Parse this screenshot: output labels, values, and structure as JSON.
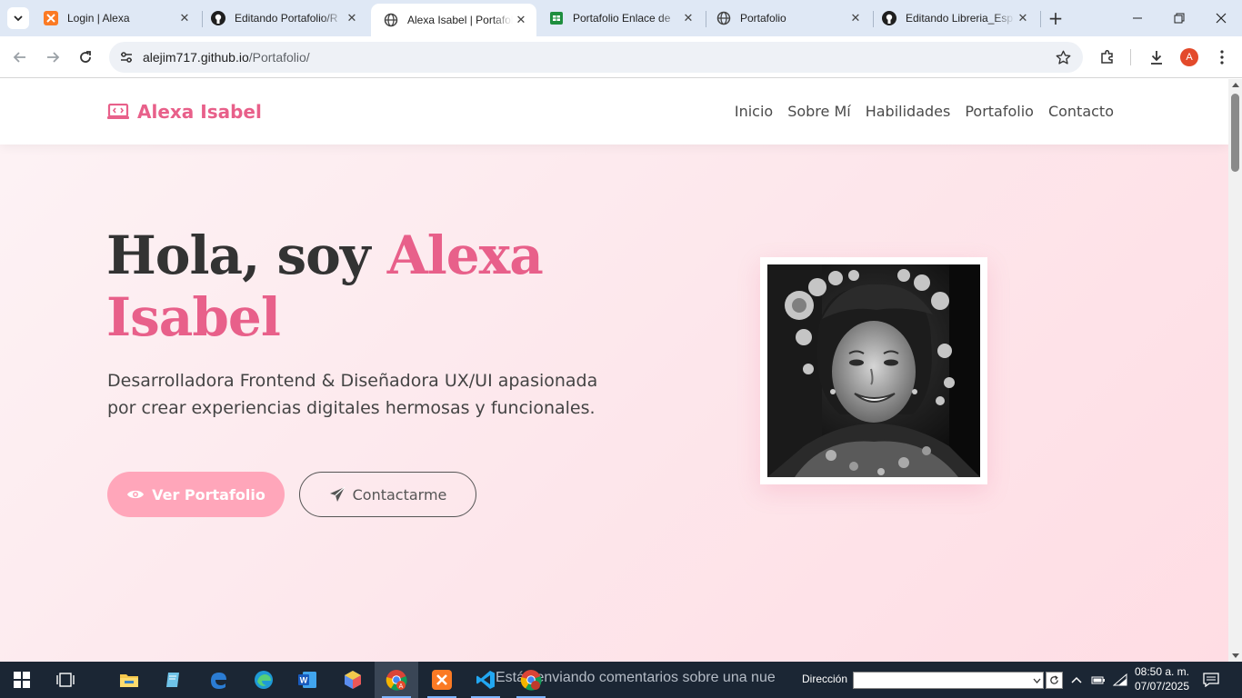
{
  "browser": {
    "tabs": [
      {
        "title": "Login | Alexa",
        "icon": "xampp-icon"
      },
      {
        "title": "Editando Portafolio/R",
        "icon": "github-icon"
      },
      {
        "title": "Alexa Isabel | Portafol",
        "icon": "globe-icon",
        "active": true
      },
      {
        "title": "Portafolio Enlace de",
        "icon": "sheets-icon"
      },
      {
        "title": "Portafolio",
        "icon": "globe-icon"
      },
      {
        "title": "Editando Libreria_Esp",
        "icon": "github-icon"
      }
    ],
    "url_host": "alejim717.github.io",
    "url_path": "/Portafolio/",
    "profile_initial": "A"
  },
  "site": {
    "logo_text": "Alexa Isabel",
    "nav": [
      "Inicio",
      "Sobre Mí",
      "Habilidades",
      "Portafolio",
      "Contacto"
    ],
    "hero": {
      "greeting": "Hola, soy ",
      "name": "Alexa Isabel",
      "description": "Desarrolladora Frontend & Diseñadora UX/UI apasionada por crear experiencias digitales hermosas y funcionales.",
      "primary_button": "Ver Portafolio",
      "secondary_button": "Contactarme"
    },
    "colors": {
      "accent": "#e8608a",
      "button_pink": "#ffa6ba",
      "text_dark": "#333333"
    }
  },
  "taskbar": {
    "ghost_text": "Estás enviando comentarios sobre una nue",
    "address_label": "Dirección",
    "time": "08:50 a. m.",
    "date": "07/07/2025"
  }
}
